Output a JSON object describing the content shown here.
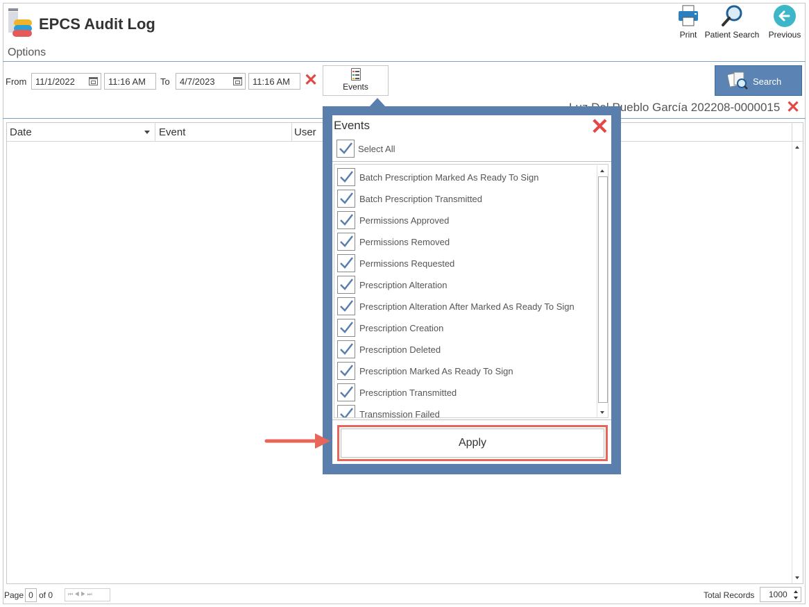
{
  "app": {
    "title": "EPCS Audit Log",
    "options_label": "Options"
  },
  "toolbar": {
    "print_label": "Print",
    "patient_search_label": "Patient Search",
    "previous_label": "Previous"
  },
  "filters": {
    "from_label": "From",
    "from_date": "11/1/2022",
    "from_time": "11:16 AM",
    "to_label": "To",
    "to_date": "4/7/2023",
    "to_time": "11:16 AM",
    "events_label": "Events",
    "search_label": "Search"
  },
  "patient": {
    "name": "Luz Del Pueblo García 202208-0000015"
  },
  "grid": {
    "columns": [
      "Date",
      "Event",
      "User"
    ]
  },
  "footer": {
    "page_label": "Page",
    "page_value": "0",
    "of_label": "of 0",
    "total_label": "Total Records",
    "total_value": "1000"
  },
  "events_popup": {
    "title": "Events",
    "select_all_label": "Select All",
    "items": [
      "Batch Prescription Marked As Ready To Sign",
      "Batch Prescription Transmitted",
      "Permissions Approved",
      "Permissions Removed",
      "Permissions Requested",
      "Prescription Alteration",
      "Prescription Alteration After Marked As Ready To Sign",
      "Prescription Creation",
      "Prescription Deleted",
      "Prescription Marked As Ready To Sign",
      "Prescription Transmitted",
      "Transmission Failed"
    ],
    "apply_label": "Apply"
  },
  "colors": {
    "accent": "#5b7fac",
    "search_button": "#5b84b4",
    "clear_red": "#e34848",
    "highlight": "#e8655a"
  },
  "icons": [
    "app-logo-icon",
    "printer-icon",
    "magnifier-icon",
    "back-arrow-icon",
    "calendar-icon",
    "clear-icon",
    "checklist-icon",
    "search-docs-icon",
    "checkmark-icon",
    "close-icon"
  ]
}
